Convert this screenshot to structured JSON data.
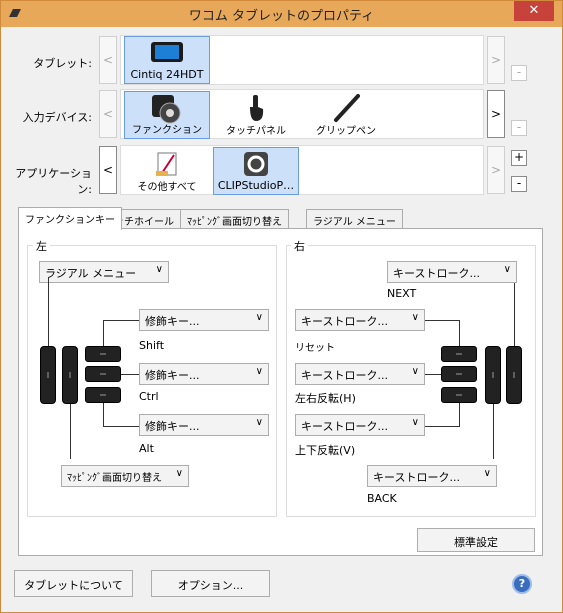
{
  "window": {
    "title": "ワコム タブレットのプロパティ",
    "close_glyph": "✕"
  },
  "rows": {
    "tablet": {
      "label": "タブレット:",
      "items": [
        {
          "caption": "Cintiq 24HDT"
        }
      ]
    },
    "device": {
      "label": "入力デバイス:",
      "items": [
        {
          "caption": "ファンクション"
        },
        {
          "caption": "タッチパネル"
        },
        {
          "caption": "グリップペン"
        }
      ]
    },
    "app": {
      "label": "アプリケーション:",
      "items": [
        {
          "caption": "その他すべて"
        },
        {
          "caption": "CLIPStudioP…"
        }
      ]
    }
  },
  "nav": {
    "left": "<",
    "right": ">"
  },
  "pm": {
    "plus": "+",
    "minus": "-"
  },
  "tabs": [
    "ファンクションキー",
    "タッチホイール",
    "ﾏｯﾋﾟﾝｸﾞ画面切り替え",
    "ラジアル メニュー"
  ],
  "left": {
    "title": "左",
    "top_dropdown": "ラジアル メニュー",
    "mod1": "修飾キー...",
    "mod1_caption": "Shift",
    "mod2": "修飾キー...",
    "mod2_caption": "Ctrl",
    "mod3": "修飾キー...",
    "mod3_caption": "Alt",
    "bottom_dropdown": "ﾏｯﾋﾟﾝｸﾞ画面切り替え"
  },
  "right": {
    "title": "右",
    "top_dropdown": "キーストローク...",
    "top_caption": "NEXT",
    "k1": "キーストローク...",
    "k1_caption": "リセット",
    "k2": "キーストローク...",
    "k2_caption": "左右反転(H)",
    "k3": "キーストローク...",
    "k3_caption": "上下反転(V)",
    "bottom_dropdown": "キーストローク...",
    "bottom_caption": "BACK"
  },
  "dropdown_arrow": "∨",
  "default_button": "標準設定",
  "footer": {
    "about": "タブレットについて",
    "options": "オプション...",
    "help": "?"
  },
  "colors": {
    "selection": "#cce0fa",
    "titlebar": "#e8a85a",
    "close": "#c7423a"
  }
}
